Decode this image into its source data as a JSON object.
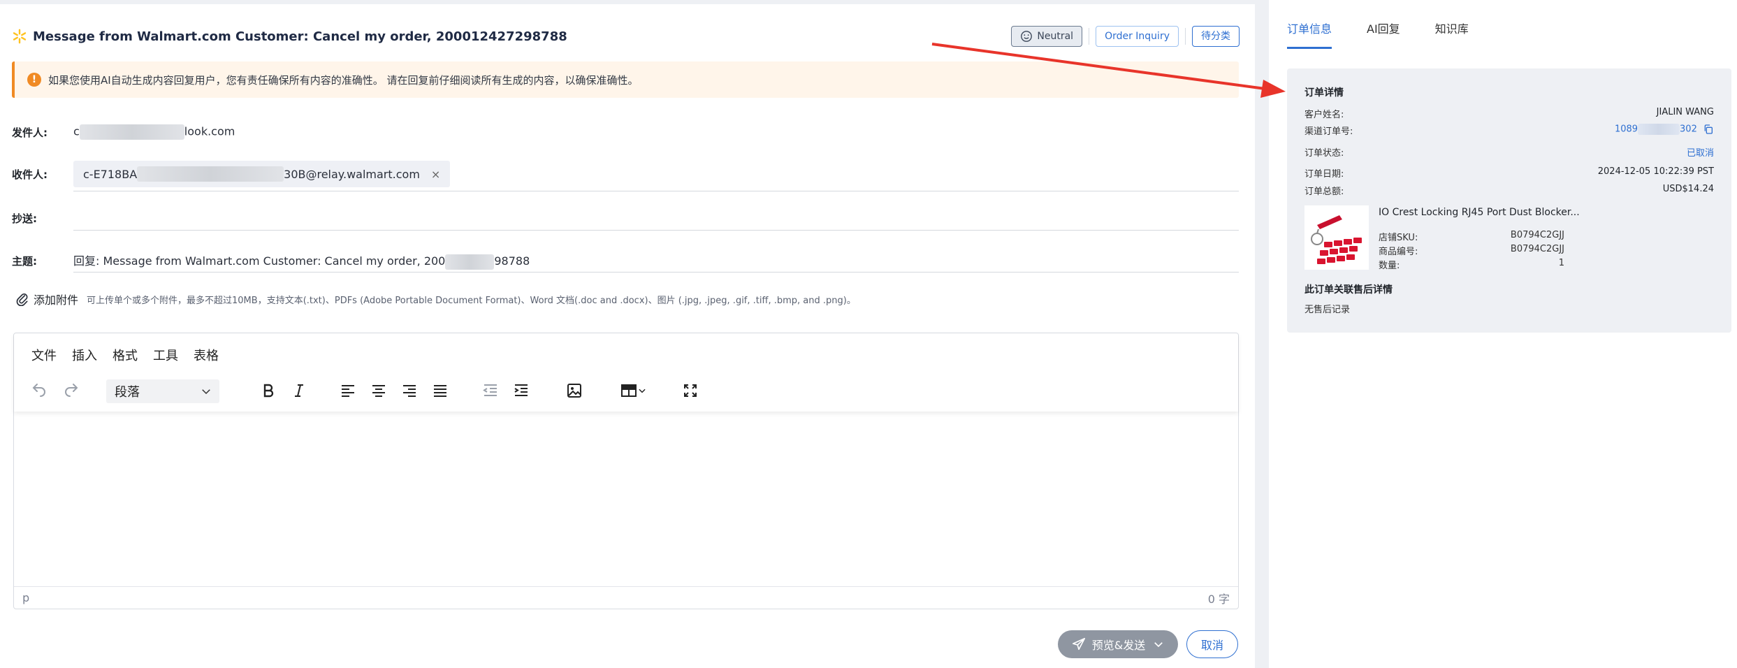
{
  "message": {
    "title": "Message from Walmart.com Customer: Cancel my order, 200012427298788",
    "tags": {
      "neutral": "Neutral",
      "inquiry": "Order Inquiry",
      "pending": "待分类"
    },
    "warning": "如果您使用AI自动生成内容回复用户，您有责任确保所有内容的准确性。 请在回复前仔细阅读所有生成的内容，以确保准确性。"
  },
  "fields": {
    "from_label": "发件人:",
    "from_prefix": "c",
    "from_suffix": "look.com",
    "to_label": "收件人:",
    "to_prefix": "c-E718BA",
    "to_suffix": "30B@relay.walmart.com",
    "to_remove": "×",
    "cc_label": "抄送:",
    "subject_label": "主题:",
    "subject_prefix": "回复: Message from Walmart.com Customer:  Cancel my order, 200",
    "subject_suffix": "98788"
  },
  "attachment": {
    "label": "添加附件",
    "hint": "可上传单个或多个附件，最多不超过10MB，支持文本(.txt)、PDFs (Adobe Portable Document Format)、Word 文档(.doc and .docx)、图片 (.jpg, .jpeg, .gif, .tiff, .bmp, and .png)。"
  },
  "editor": {
    "menu": [
      "文件",
      "插入",
      "格式",
      "工具",
      "表格"
    ],
    "block_format": "段落",
    "status_path": "p",
    "word_count": "0 字"
  },
  "actions": {
    "send": "预览&发送",
    "cancel": "取消"
  },
  "sidebar": {
    "tabs": [
      "订单信息",
      "AI回复",
      "知识库"
    ],
    "order": {
      "title": "订单详情",
      "customer_label": "客户姓名:",
      "customer_value": "JIALIN WANG",
      "channel_label": "渠道订单号:",
      "channel_prefix": "1089",
      "channel_suffix": "302",
      "status_label": "订单状态:",
      "status_value": "已取消",
      "date_label": "订单日期:",
      "date_value": "2024-12-05 10:22:39 PST",
      "total_label": "订单总额:",
      "total_value": "USD$14.24",
      "product_name": "IO Crest Locking RJ45 Port Dust Blocker...",
      "sku_label": "店铺SKU:",
      "sku_value": "B0794C2GJJ",
      "item_label": "商品编号:",
      "item_value": "B0794C2GJJ",
      "qty_label": "数量:",
      "qty_value": "1",
      "after_title": "此订单关联售后详情",
      "after_text": "无售后记录"
    }
  },
  "colors": {
    "accent": "#2e6fd1",
    "warning": "#f08a24",
    "walmart": "#ffc220",
    "annotation": "#e8342a"
  }
}
